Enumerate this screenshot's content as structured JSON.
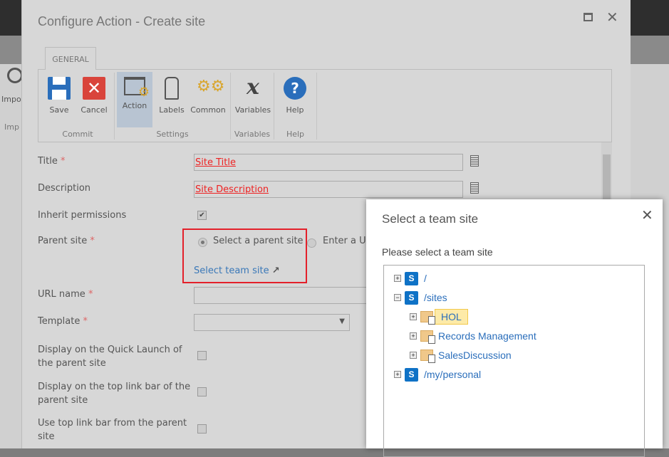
{
  "background": {
    "import_label": "Impo",
    "import_group": "Imp"
  },
  "dialog": {
    "title": "Configure Action - Create site",
    "tab": "GENERAL",
    "ribbon": {
      "buttons": [
        {
          "label": "Save",
          "icon": "save-icon"
        },
        {
          "label": "Cancel",
          "icon": "cancel-icon"
        },
        {
          "label": "Action",
          "icon": "action-icon",
          "active": true
        },
        {
          "label": "Labels",
          "icon": "labels-icon"
        },
        {
          "label": "Common",
          "icon": "gears-icon"
        },
        {
          "label": "Variables",
          "icon": "variables-icon"
        },
        {
          "label": "Help",
          "icon": "help-icon"
        }
      ],
      "groups": [
        "Commit",
        "Settings",
        "Variables",
        "Help"
      ]
    },
    "form": {
      "title_label": "Title",
      "title_value": "Site Title",
      "description_label": "Description",
      "description_value": "Site Description",
      "inherit_label": "Inherit permissions",
      "inherit_checked": true,
      "parent_label": "Parent site",
      "parent_option1": "Select a parent site",
      "parent_option2": "Enter a URL",
      "select_team_site_link": "Select team site",
      "url_label": "URL name",
      "template_label": "Template",
      "quick_launch_label": "Display on the Quick Launch of the parent site",
      "top_link_label": "Display on the top link bar of the parent site",
      "use_top_link_label": "Use top link bar from the parent site",
      "required_mark": "*"
    }
  },
  "popup": {
    "title": "Select a team site",
    "subtitle": "Please select a team site",
    "tree": [
      {
        "label": "/",
        "toggle": "+"
      },
      {
        "label": "/sites",
        "toggle": "−"
      },
      {
        "label": "HOL",
        "toggle": "+",
        "selected": true
      },
      {
        "label": "Records Management",
        "toggle": "+"
      },
      {
        "label": "SalesDiscussion",
        "toggle": "+"
      },
      {
        "label": "/my/personal",
        "toggle": "+"
      }
    ]
  },
  "colors": {
    "accent": "#2a6ebb",
    "highlight": "#e3202a"
  }
}
